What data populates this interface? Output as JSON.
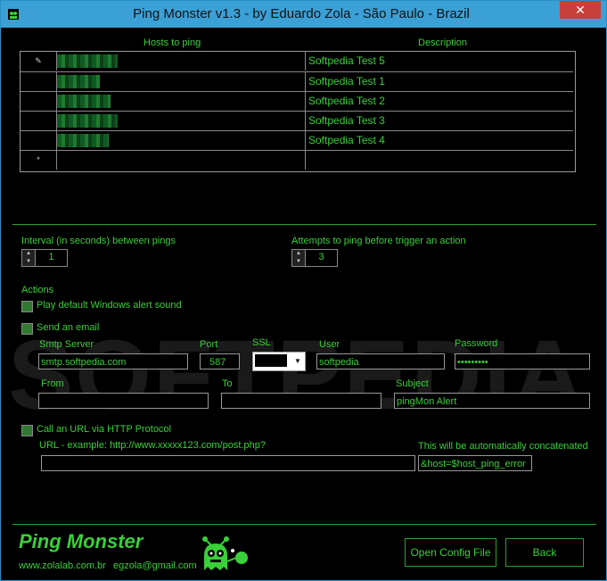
{
  "window": {
    "title": "Ping Monster v1.3  -  by Eduardo Zola  - São Paulo - Brazil",
    "close_label": "✕"
  },
  "grid": {
    "col_hosts": "Hosts to ping",
    "col_description": "Description",
    "rows": [
      {
        "marker": "✎",
        "host": "",
        "description": "Softpedia Test 5"
      },
      {
        "marker": "",
        "host": "",
        "description": "Softpedia Test 1"
      },
      {
        "marker": "",
        "host": "",
        "description": "Softpedia Test 2"
      },
      {
        "marker": "",
        "host": "",
        "description": "Softpedia Test 3"
      },
      {
        "marker": "",
        "host": "",
        "description": "Softpedia Test 4"
      },
      {
        "marker": "*",
        "host": "",
        "description": ""
      }
    ]
  },
  "interval": {
    "label": "Interval (in seconds) between pings",
    "value": "1"
  },
  "attempts": {
    "label": "Attempts to ping before trigger an action",
    "value": "3"
  },
  "actions": {
    "label": "Actions",
    "play_sound": "Play default Windows alert sound",
    "send_email": "Send an email",
    "call_url": "Call an URL via HTTP Protocol"
  },
  "email": {
    "smtp_label": "Smtp Server",
    "smtp_value": "smtp.softpedia.com",
    "port_label": "Port",
    "port_value": "587",
    "ssl_label": "SSL",
    "user_label": "User",
    "user_value": "softpedia",
    "password_label": "Password",
    "password_value": "•••••••••",
    "from_label": "From",
    "from_value": "",
    "to_label": "To",
    "to_value": "",
    "subject_label": "Subject",
    "subject_value": "pingMon Alert"
  },
  "url": {
    "label": "URL  -  example:  http://www.xxxxx123.com/post.php?",
    "value": "",
    "concat_label": "This will be automatically concatenated",
    "concat_value": "&host=$host_ping_error"
  },
  "footer": {
    "brand": "Ping Monster",
    "website": "www.zolalab.com.br",
    "email": "egzola@gmail.com",
    "open_config": "Open Config File",
    "back": "Back"
  },
  "watermark": "SOFTPEDIA",
  "colors": {
    "accent": "#39d039",
    "background": "#000000",
    "titlebar": "#3aa0d6"
  }
}
